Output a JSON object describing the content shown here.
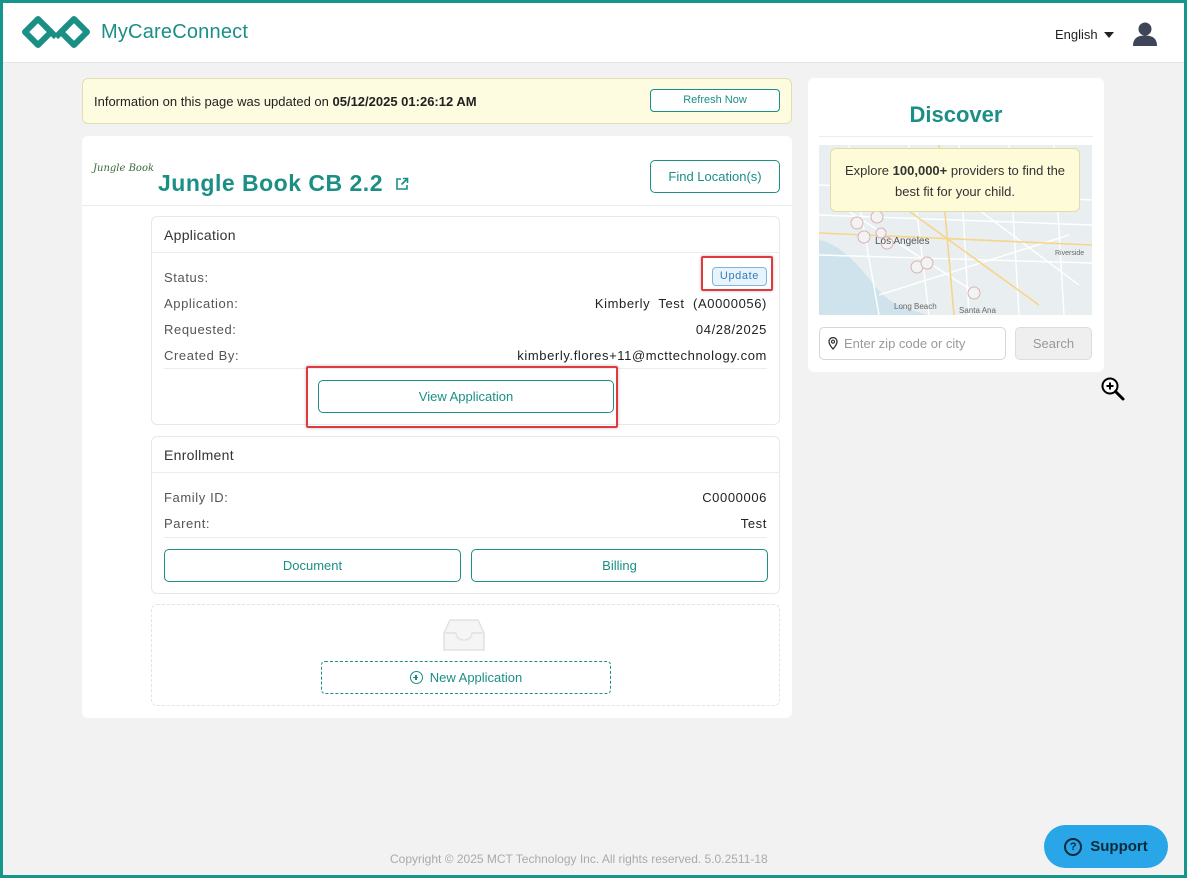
{
  "header": {
    "app_name": "MyCareConnect",
    "language": "English"
  },
  "banner": {
    "text_prefix": "Information on this page was updated on ",
    "updated_at": "05/12/2025 01:26:12 AM",
    "refresh_label": "Refresh Now"
  },
  "provider": {
    "logo_text": "Jungle Book",
    "name": "Jungle Book CB 2.2",
    "find_locations_label": "Find Location(s)"
  },
  "application": {
    "heading": "Application",
    "status_label": "Status:",
    "status_value": "Update",
    "application_label": "Application:",
    "application_value": "Kimberly  Test  (A0000056)",
    "requested_label": "Requested:",
    "requested_value": "04/28/2025",
    "created_by_label": "Created By:",
    "created_by_value": "kimberly.flores+11@mcttechnology.com",
    "view_label": "View Application"
  },
  "enrollment": {
    "heading": "Enrollment",
    "family_id_label": "Family ID:",
    "family_id_value": "C0000006",
    "parent_label": "Parent:",
    "parent_value": "Test",
    "document_label": "Document",
    "billing_label": "Billing"
  },
  "new_application": {
    "label": "New Application"
  },
  "discover": {
    "title": "Discover",
    "callout_prefix": "Explore ",
    "callout_bold": "100,000+",
    "callout_suffix": " providers to find the best fit for your child.",
    "map_labels": [
      "Los Angeles",
      "Long Beach",
      "Santa Ana",
      "Riverside"
    ],
    "search_placeholder": "Enter zip code or city",
    "search_label": "Search"
  },
  "footer": {
    "copyright": "Copyright © 2025 MCT Technology Inc. All rights reserved. 5.0.2511-18"
  },
  "support": {
    "label": "Support"
  },
  "colors": {
    "brand": "#1b8f86",
    "highlight": "#e0393e",
    "support": "#29a6e8",
    "banner_bg": "#fdfbe0"
  }
}
